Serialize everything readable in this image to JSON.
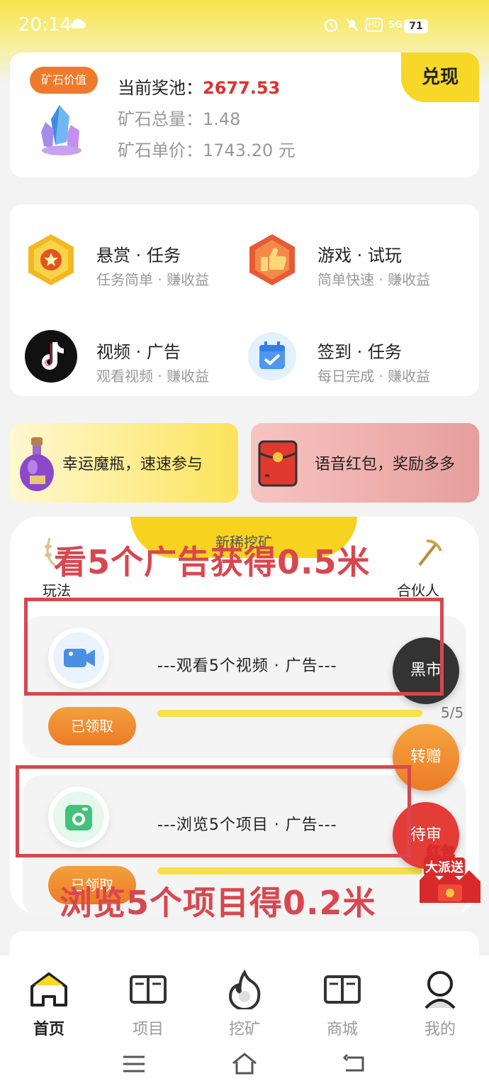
{
  "status_bar": {
    "time": "20:14",
    "network": "5G",
    "battery": "71"
  },
  "pool": {
    "tag": "矿石价值",
    "pool_label": "当前奖池：",
    "pool_value": "2677.53",
    "total_line": "矿石总量：1.48",
    "price_line": "矿石单价：1743.20 元",
    "redeem_button": "兑现"
  },
  "tasks": [
    {
      "title": "悬赏 · 任务",
      "subtitle": "任务简单 · 赚收益",
      "icon": "reward-badge-icon"
    },
    {
      "title": "游戏 · 试玩",
      "subtitle": "简单快速 · 赚收益",
      "icon": "thumbs-up-badge-icon"
    },
    {
      "title": "视频 · 广告",
      "subtitle": "观看视频 · 赚收益",
      "icon": "tiktok-icon"
    },
    {
      "title": "签到 · 任务",
      "subtitle": "每日完成 · 赚收益",
      "icon": "calendar-check-icon"
    }
  ],
  "promos": {
    "left": "幸运魔瓶，速速参与",
    "right": "语音红包，奖励多多"
  },
  "mining": {
    "tab_label": "新稀挖矿",
    "left_label": "玩法",
    "right_label": "合伙人",
    "rows": [
      {
        "text": "---观看5个视频 · 广告---",
        "button": "已领取",
        "count": "5/5"
      },
      {
        "text": "---浏览5个项目 · 广告---",
        "button": "已领取"
      }
    ],
    "float_buttons": {
      "black_market": "黑市",
      "transfer": "转赠",
      "pending": "待审"
    }
  },
  "annotations": {
    "top": "看5个广告获得0.5米",
    "bottom": "浏览5个项目得0.2米"
  },
  "sticker": {
    "line1": "红包",
    "line2": "大派送"
  },
  "tabbar": [
    {
      "label": "首页",
      "active": true
    },
    {
      "label": "项目"
    },
    {
      "label": "挖矿"
    },
    {
      "label": "商城"
    },
    {
      "label": "我的"
    }
  ],
  "colors": {
    "accent_yellow": "#f7d727",
    "accent_red": "#e03030",
    "annotation_red": "#d8474f",
    "orange": "#ec7b26"
  }
}
